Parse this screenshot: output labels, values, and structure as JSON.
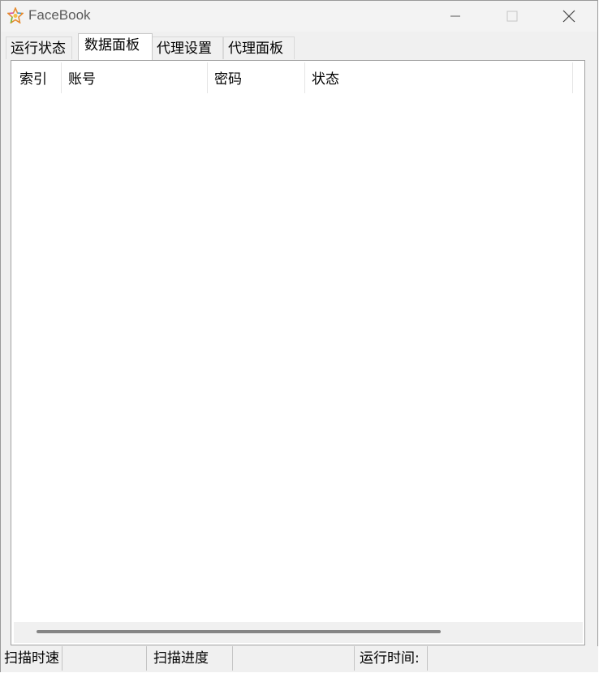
{
  "window": {
    "title": "FaceBook",
    "icons": {
      "app": "star-icon",
      "minimize": "minimize-icon",
      "maximize": "maximize-icon",
      "close": "close-icon"
    }
  },
  "tabs": [
    {
      "label": "运行状态",
      "active": false
    },
    {
      "label": "数据面板",
      "active": true
    },
    {
      "label": "代理设置",
      "active": false
    },
    {
      "label": "代理面板",
      "active": false
    }
  ],
  "table": {
    "columns": [
      "索引",
      "账号",
      "密码",
      "状态"
    ],
    "rows": []
  },
  "statusbar": {
    "scan_speed_label": "扫描时速",
    "scan_speed_value": "",
    "scan_progress_label": "扫描进度",
    "scan_progress_value": "",
    "run_time_label": "运行时间:",
    "run_time_value": ""
  },
  "colors": {
    "window_bg": "#f0f0f0",
    "panel_bg": "#ffffff",
    "scroll_thumb": "#858585"
  }
}
